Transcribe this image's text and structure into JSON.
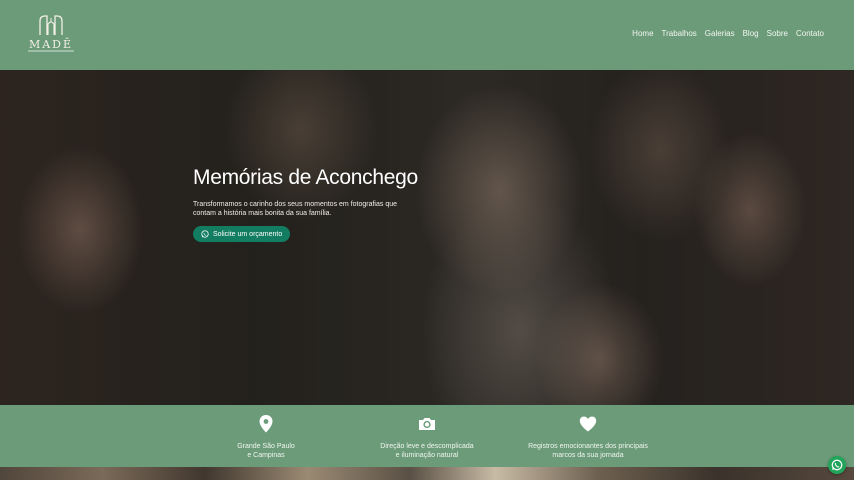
{
  "brand": {
    "name": "MADÊ"
  },
  "nav": [
    "Home",
    "Trabalhos",
    "Galerias",
    "Blog",
    "Sobre",
    "Contato"
  ],
  "hero": {
    "title": "Memórias de Aconchego",
    "text": "Transformamos o carinho dos seus momentos em fotografias que contam a história mais bonita da sua família.",
    "cta_label": "Solicite um orçamento",
    "cta_icon": "whatsapp-icon"
  },
  "features": [
    {
      "icon": "map-pin-icon",
      "line1": "Grande São Paulo",
      "line2": "e Campinas"
    },
    {
      "icon": "camera-icon",
      "line1": "Direção leve e descomplicada",
      "line2": "e iluminação natural"
    },
    {
      "icon": "heart-icon",
      "line1": "Registros emocionantes dos principais",
      "line2": "marcos da sua jornada"
    }
  ],
  "colors": {
    "header_bg": "#6b9b79",
    "cta_bg": "#137d61",
    "whatsapp": "#22a55b"
  }
}
